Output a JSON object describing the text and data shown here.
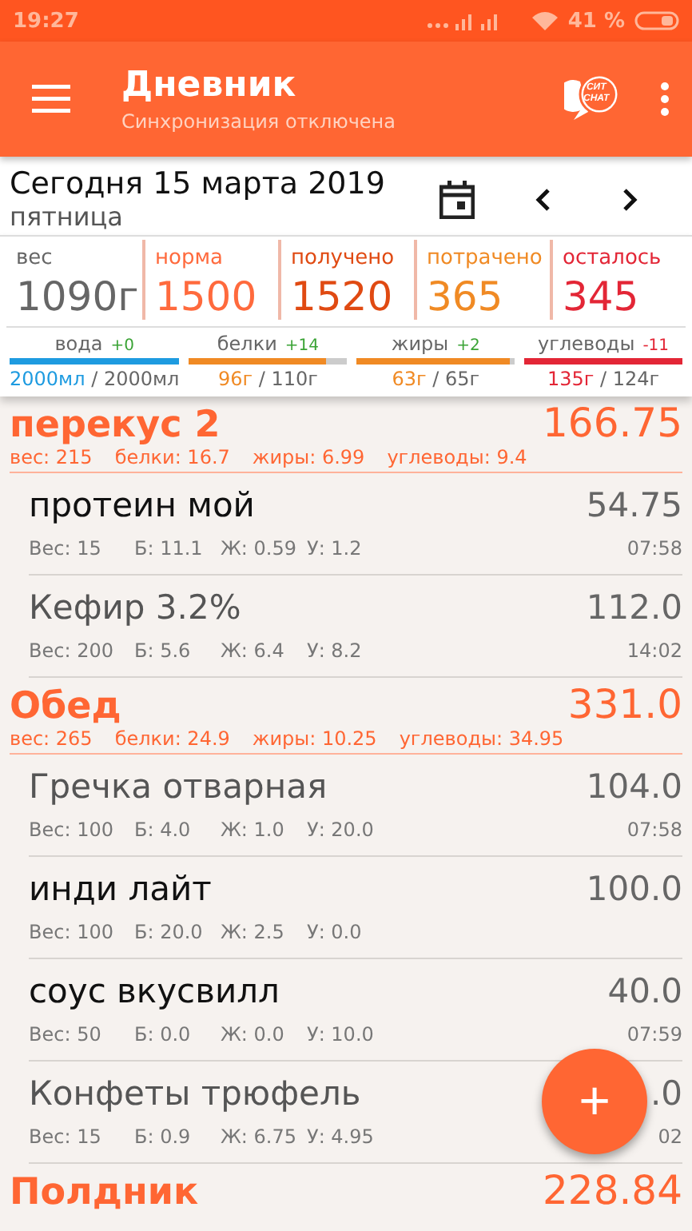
{
  "status_bar": {
    "time": "19:27",
    "battery_text": "41 %"
  },
  "app_bar": {
    "title": "Дневник",
    "subtitle": "Синхронизация отключена",
    "chat_logo": [
      "СИТ",
      "CHAT"
    ]
  },
  "date_bar": {
    "date": "Сегодня 15 марта 2019",
    "weekday": "пятница"
  },
  "stats": [
    {
      "label": "вес",
      "value": "1090г",
      "color": "#666666"
    },
    {
      "label": "норма",
      "value": "1500",
      "color": "#ff6a3d"
    },
    {
      "label": "получено",
      "value": "1520",
      "color": "#e04a12"
    },
    {
      "label": "потрачено",
      "value": "365",
      "color": "#f08a24"
    },
    {
      "label": "осталось",
      "value": "345",
      "color": "#e32636"
    }
  ],
  "macro_separator": "/",
  "macros": [
    {
      "label": "вода",
      "delta": "+0",
      "over": false,
      "level": 1.0,
      "color": "#1e9be0",
      "eaten": "2000мл",
      "target": "2000мл"
    },
    {
      "label": "белки",
      "delta": "+14",
      "over": false,
      "level": 0.87,
      "color": "#f08a24",
      "eaten": "96г",
      "target": "110г"
    },
    {
      "label": "жиры",
      "delta": "+2",
      "over": false,
      "level": 0.97,
      "color": "#f08a24",
      "eaten": "63г",
      "target": "65г"
    },
    {
      "label": "углеводы",
      "delta": "-11",
      "over": true,
      "level": 1.0,
      "color": "#e32636",
      "eaten": "135г",
      "target": "124г"
    }
  ],
  "meals": [
    {
      "name": "перекус 2",
      "total": "166.75",
      "summary": [
        "вес: 215",
        "белки: 16.7",
        "жиры: 6.99",
        "углеводы: 9.4"
      ],
      "items": [
        {
          "name": "протеин мой",
          "kind": "own",
          "calories": "54.75",
          "weight": "Вес: 15",
          "protein": "Б: 11.1",
          "fat": "Ж: 0.59",
          "carbs": "У: 1.2",
          "time": "07:58"
        },
        {
          "name": "Кефир 3.2%",
          "kind": "base",
          "calories": "112.0",
          "weight": "Вес: 200",
          "protein": "Б: 5.6",
          "fat": "Ж: 6.4",
          "carbs": "У: 8.2",
          "time": "14:02"
        }
      ]
    },
    {
      "name": "Обед",
      "total": "331.0",
      "summary": [
        "вес: 265",
        "белки: 24.9",
        "жиры: 10.25",
        "углеводы: 34.95"
      ],
      "items": [
        {
          "name": "Гречка отварная",
          "kind": "base",
          "calories": "104.0",
          "weight": "Вес: 100",
          "protein": "Б: 4.0",
          "fat": "Ж: 1.0",
          "carbs": "У: 20.0",
          "time": "07:58"
        },
        {
          "name": "инди лайт",
          "kind": "own",
          "calories": "100.0",
          "weight": "Вес: 100",
          "protein": "Б: 20.0",
          "fat": "Ж: 2.5",
          "carbs": "У: 0.0"
        },
        {
          "name": "соус вкусвилл",
          "kind": "own",
          "calories": "40.0",
          "weight": "Вес: 50",
          "protein": "Б: 0.0",
          "fat": "Ж: 0.0",
          "carbs": "У: 10.0",
          "time": "07:59"
        },
        {
          "name": "Конфеты трюфель",
          "kind": "base",
          "calories": ".0",
          "weight": "Вес: 15",
          "protein": "Б: 0.9",
          "fat": "Ж: 6.75",
          "carbs": "У: 4.95",
          "time": "02"
        }
      ]
    },
    {
      "name": "Полдник",
      "total": "228.84"
    }
  ],
  "fab": {
    "label": "+"
  }
}
